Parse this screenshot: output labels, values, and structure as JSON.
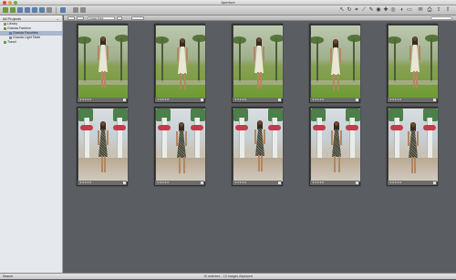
{
  "app": {
    "title": "Aperture",
    "traffic_colors": [
      "#e0443e",
      "#dea236",
      "#5fb44a"
    ]
  },
  "toolbar": {
    "left_icons": [
      "import-icon",
      "new-project-icon",
      "new-album-icon",
      "new-smart-album-icon",
      "book-icon",
      "web-icon",
      "light-table-icon",
      "stack-icon",
      "rotate-left-icon",
      "rotate-right-icon"
    ],
    "right_icons": [
      "select-tool-icon",
      "rotate-tool-icon",
      "crop-tool-icon",
      "straighten-tool-icon",
      "lift-stamp-icon",
      "redeye-icon",
      "patch-icon",
      "loupe-icon",
      "adjust-icon",
      "full-screen-icon",
      "email-icon",
      "print-icon",
      "export-icon"
    ]
  },
  "sidebar": {
    "header": "All Projects",
    "items": [
      {
        "label": "Library",
        "level": 1,
        "selected": false,
        "icon": "library-icon",
        "color": "#8a8a8a"
      },
      {
        "label": "Granda Fashion",
        "level": 1,
        "selected": false,
        "icon": "project-icon",
        "color": "#6a9a3c"
      },
      {
        "label": "Granda Favorites",
        "level": 2,
        "selected": true,
        "icon": "album-icon",
        "color": "#5a7fb0"
      },
      {
        "label": "Granda Light Table",
        "level": 2,
        "selected": false,
        "icon": "light-table-icon",
        "color": "#8a8a8a"
      },
      {
        "label": "Travel",
        "level": 1,
        "selected": false,
        "icon": "project-icon",
        "color": "#6a9a3c"
      }
    ]
  },
  "browser": {
    "sort_field": "Image Date"
  },
  "thumbnails": [
    {
      "scene": "park",
      "rating": "★★★★★"
    },
    {
      "scene": "park",
      "rating": "★★★★★"
    },
    {
      "scene": "park",
      "rating": "★★★★★"
    },
    {
      "scene": "park",
      "rating": "★★★★★"
    },
    {
      "scene": "park",
      "rating": "★★★★★"
    },
    {
      "scene": "street",
      "rating": "★★★★★"
    },
    {
      "scene": "street",
      "rating": "★★★★★"
    },
    {
      "scene": "street",
      "rating": "★★★★★"
    },
    {
      "scene": "street",
      "rating": "★★★★★"
    },
    {
      "scene": "street",
      "rating": "★★★★★"
    }
  ],
  "status": {
    "left": "Search",
    "center": "10 selected – 10 images displayed"
  }
}
